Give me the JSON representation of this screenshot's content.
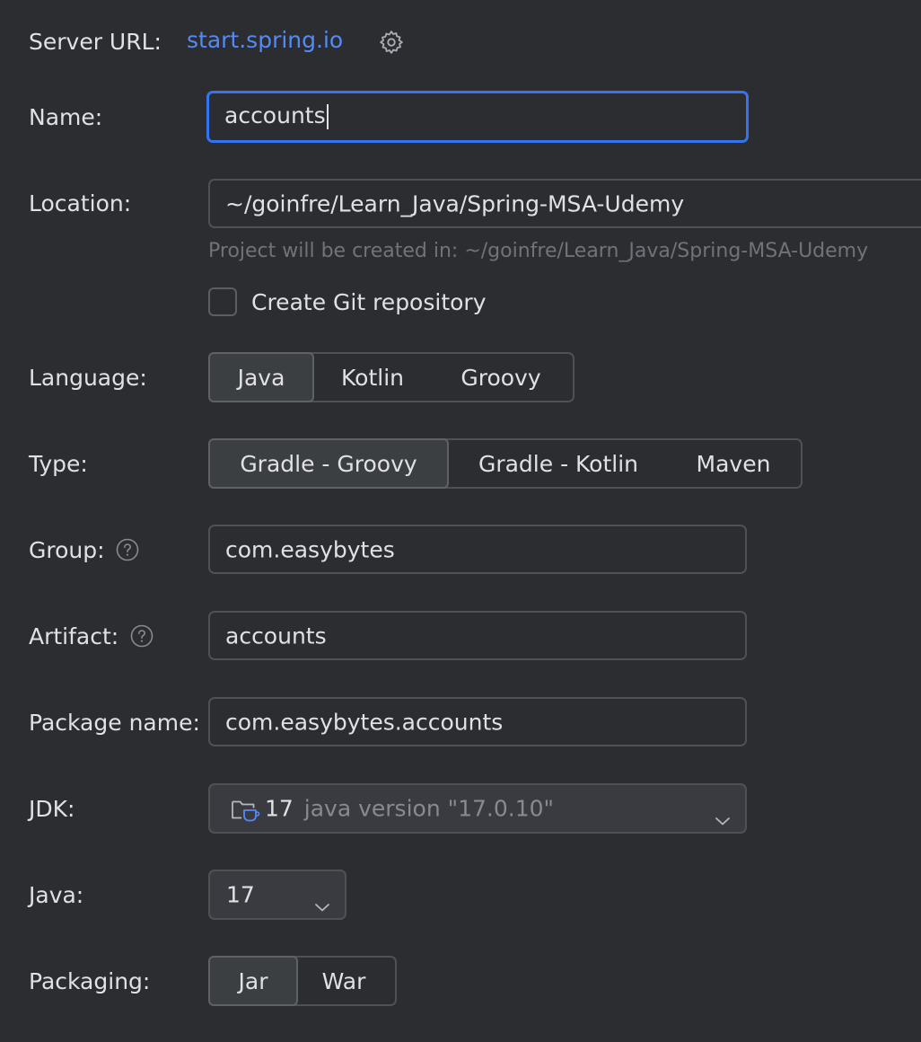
{
  "server": {
    "label": "Server URL:",
    "url": "start.spring.io",
    "settings_icon": "gear-icon"
  },
  "name": {
    "label": "Name:",
    "value": "accounts"
  },
  "location": {
    "label": "Location:",
    "value": "~/goinfre/Learn_Java/Spring-MSA-Udemy",
    "hint": "Project will be created in: ~/goinfre/Learn_Java/Spring-MSA-Udemy"
  },
  "git": {
    "label": "Create Git repository",
    "checked": false
  },
  "language": {
    "label": "Language:",
    "options": [
      "Java",
      "Kotlin",
      "Groovy"
    ],
    "selected": "Java"
  },
  "type": {
    "label": "Type:",
    "options": [
      "Gradle - Groovy",
      "Gradle - Kotlin",
      "Maven"
    ],
    "selected": "Gradle - Groovy"
  },
  "group": {
    "label": "Group:",
    "value": "com.easybytes",
    "help_icon": "question-icon"
  },
  "artifact": {
    "label": "Artifact:",
    "value": "accounts",
    "help_icon": "question-icon"
  },
  "package_name": {
    "label": "Package name:",
    "value": "com.easybytes.accounts"
  },
  "jdk": {
    "label": "JDK:",
    "version": "17",
    "detail": "java version \"17.0.10\"",
    "icon": "jdk-folder-icon"
  },
  "java": {
    "label": "Java:",
    "value": "17"
  },
  "packaging": {
    "label": "Packaging:",
    "options": [
      "Jar",
      "War"
    ],
    "selected": "Jar"
  },
  "colors": {
    "background": "#2b2d30",
    "text": "#dfe1e5",
    "link": "#548af7",
    "focus_border": "#3574f0",
    "muted": "#6f737a"
  }
}
